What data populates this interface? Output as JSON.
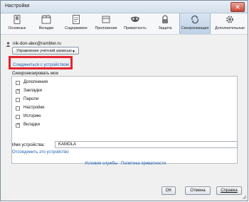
{
  "window": {
    "title": "Настройки",
    "close_glyph": "✕"
  },
  "toolbar": {
    "tabs": [
      {
        "label": "Основные",
        "icon": "toggle-switch-icon"
      },
      {
        "label": "Вкладки",
        "icon": "tabs-icon"
      },
      {
        "label": "Содержимое",
        "icon": "document-icon"
      },
      {
        "label": "Приложения",
        "icon": "applications-icon"
      },
      {
        "label": "Приватность",
        "icon": "mask-icon"
      },
      {
        "label": "Защита",
        "icon": "lock-icon"
      },
      {
        "label": "Синхронизация",
        "icon": "sync-icon",
        "active": true
      },
      {
        "label": "Дополнительные",
        "icon": "gear-icon"
      }
    ]
  },
  "sync": {
    "account_email": "nik-don-alex@rambler.ru",
    "manage_account_label": "Управление учётной записью",
    "connect_device_label": "Соединиться с устройством",
    "sync_my_label": "Синхронизировать мои",
    "items": [
      {
        "label": "Дополнения",
        "checked": false
      },
      {
        "label": "Закладки",
        "checked": true
      },
      {
        "label": "Пароли",
        "checked": false
      },
      {
        "label": "Настройки",
        "checked": false
      },
      {
        "label": "Историю",
        "checked": false
      },
      {
        "label": "Вкладки",
        "checked": true
      }
    ],
    "device_name_label": "Имя устройства:",
    "device_name_value": "KAMOLA",
    "disconnect_label": "Отсоединить это устройство",
    "terms_label": "Условия службы",
    "privacy_label": "Политика приватности"
  },
  "buttons": {
    "ok": "OK",
    "cancel": "Отмена",
    "help": "Справка"
  },
  "colors": {
    "link": "#1b5fb4",
    "highlight": "#e5242e",
    "active_tab": "#c6d8eb"
  }
}
